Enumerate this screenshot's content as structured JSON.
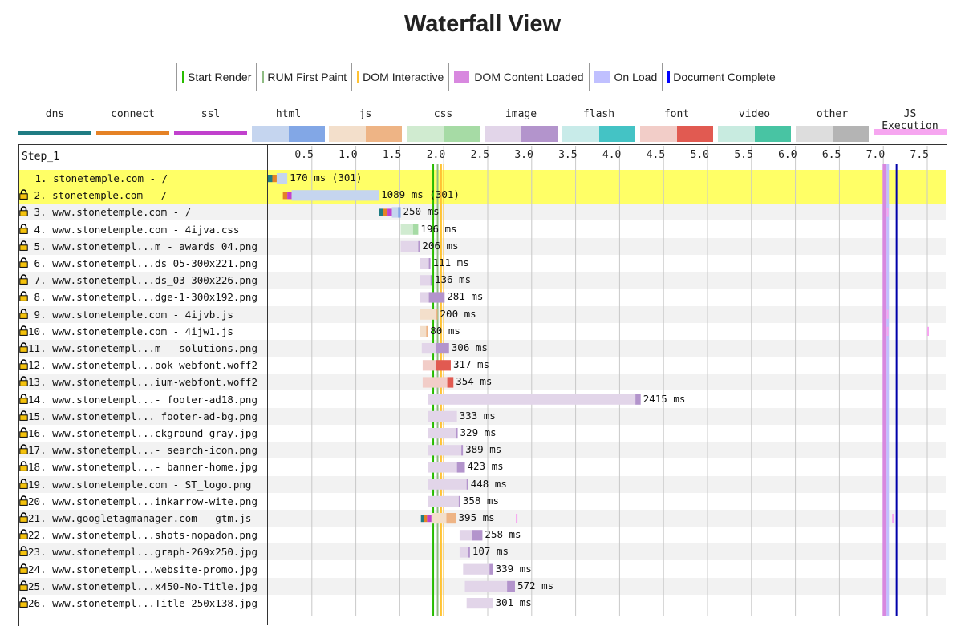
{
  "title": "Waterfall View",
  "legend": [
    {
      "label": "Start Render",
      "color": "#28BC00",
      "kind": "line"
    },
    {
      "label": "RUM First Paint",
      "color": "#8FBC83",
      "kind": "line"
    },
    {
      "label": "DOM Interactive",
      "color": "#FFC233",
      "kind": "line"
    },
    {
      "label": "DOM Content Loaded",
      "color": "#D888DF",
      "kind": "box"
    },
    {
      "label": "On Load",
      "color": "#C0C0FF",
      "kind": "box"
    },
    {
      "label": "Document Complete",
      "color": "#0000FF",
      "kind": "line"
    }
  ],
  "request_types": [
    {
      "label": "dns",
      "light": "#1f7c83",
      "dark": "#1f7c83"
    },
    {
      "label": "connect",
      "light": "#e58226",
      "dark": "#e58226"
    },
    {
      "label": "ssl",
      "light": "#c141cd",
      "dark": "#c141cd"
    },
    {
      "label": "html",
      "light": "#c5d5ef",
      "dark": "#82a7e6"
    },
    {
      "label": "js",
      "light": "#f3dfcb",
      "dark": "#eeb485"
    },
    {
      "label": "css",
      "light": "#d0ebd0",
      "dark": "#a6dba5"
    },
    {
      "label": "image",
      "light": "#e2d5e9",
      "dark": "#b394cc"
    },
    {
      "label": "flash",
      "light": "#c8ebe9",
      "dark": "#44c3c5"
    },
    {
      "label": "font",
      "light": "#f2cdc8",
      "dark": "#e15a51"
    },
    {
      "label": "video",
      "light": "#c8ebe0",
      "dark": "#48c4a3"
    },
    {
      "label": "other",
      "light": "#dddddd",
      "dark": "#b4b4b4"
    },
    {
      "label": "JS Execution",
      "light": "#f6a6f0",
      "dark": "#f6a6f0"
    }
  ],
  "chart_data": {
    "type": "waterfall",
    "step_label": "Step_1",
    "x_unit": "seconds",
    "xlim": [
      0,
      7.75
    ],
    "ticks": [
      "0.5",
      "1.0",
      "1.5",
      "2.0",
      "2.5",
      "3.0",
      "3.5",
      "4.0",
      "4.5",
      "5.0",
      "5.5",
      "6.0",
      "6.5",
      "7.0",
      "7.5"
    ],
    "markers": {
      "start_render": 1.88,
      "rum_first_paint": 1.93,
      "dom_interactive": 1.97,
      "dom_content_loaded": [
        7.01,
        7.05
      ],
      "on_load": [
        7.01,
        7.02
      ],
      "document_complete": 7.15
    },
    "requests": [
      {
        "label": "1. stonetemple.com - /",
        "secure": false,
        "highlight": true,
        "type": "html",
        "start": 0.0,
        "dns": 0.05,
        "connect": 0.05,
        "ssl": 0,
        "ttfb": 0.12,
        "download": 0.0,
        "duration": "170 ms (301)"
      },
      {
        "label": "2. stonetemple.com - /",
        "secure": true,
        "highlight": true,
        "type": "html",
        "start": 0.17,
        "dns": 0.0,
        "connect": 0.05,
        "ssl": 0.05,
        "ttfb": 0.99,
        "download": 0.0,
        "duration": "1089 ms (301)"
      },
      {
        "label": "3. www.stonetemple.com - /",
        "secure": true,
        "highlight": false,
        "type": "html",
        "start": 1.26,
        "dns": 0.05,
        "connect": 0.05,
        "ssl": 0.05,
        "ttfb": 0.07,
        "download": 0.03,
        "duration": "250 ms"
      },
      {
        "label": "4. www.stonetemple.com - 4ijva.css",
        "secure": true,
        "highlight": false,
        "type": "css",
        "start": 1.51,
        "dns": 0,
        "connect": 0,
        "ssl": 0,
        "ttfb": 0.14,
        "download": 0.06,
        "duration": "196 ms"
      },
      {
        "label": "5. www.stonetempl...m - awards_04.png",
        "secure": true,
        "highlight": false,
        "type": "image",
        "start": 1.51,
        "dns": 0,
        "connect": 0,
        "ssl": 0,
        "ttfb": 0.2,
        "download": 0.01,
        "duration": "206 ms"
      },
      {
        "label": "6. www.stonetempl...ds_05-300x221.png",
        "secure": true,
        "highlight": false,
        "type": "image",
        "start": 1.73,
        "dns": 0,
        "connect": 0,
        "ssl": 0,
        "ttfb": 0.1,
        "download": 0.01,
        "duration": "111 ms"
      },
      {
        "label": "7. www.stonetempl...ds_03-300x226.png",
        "secure": true,
        "highlight": false,
        "type": "image",
        "start": 1.73,
        "dns": 0,
        "connect": 0,
        "ssl": 0,
        "ttfb": 0.12,
        "download": 0.02,
        "duration": "136 ms"
      },
      {
        "label": "8. www.stonetempl...dge-1-300x192.png",
        "secure": true,
        "highlight": false,
        "type": "image",
        "start": 1.73,
        "dns": 0,
        "connect": 0,
        "ssl": 0,
        "ttfb": 0.1,
        "download": 0.18,
        "duration": "281 ms"
      },
      {
        "label": "9. www.stonetemple.com - 4ijvb.js",
        "secure": true,
        "highlight": false,
        "type": "js",
        "start": 1.73,
        "dns": 0,
        "connect": 0,
        "ssl": 0,
        "ttfb": 0.18,
        "download": 0.02,
        "duration": "200 ms"
      },
      {
        "label": "10. www.stonetemple.com - 4ijw1.js",
        "secure": true,
        "highlight": false,
        "type": "js",
        "start": 1.73,
        "dns": 0,
        "connect": 0,
        "ssl": 0,
        "ttfb": 0.07,
        "download": 0.01,
        "duration": "80 ms"
      },
      {
        "label": "11. www.stonetempl...m - solutions.png",
        "secure": true,
        "highlight": false,
        "type": "image",
        "start": 1.75,
        "dns": 0,
        "connect": 0,
        "ssl": 0,
        "ttfb": 0.16,
        "download": 0.15,
        "duration": "306 ms"
      },
      {
        "label": "12. www.stonetempl...ook-webfont.woff2",
        "secure": true,
        "highlight": false,
        "type": "font",
        "start": 1.76,
        "dns": 0,
        "connect": 0,
        "ssl": 0,
        "ttfb": 0.15,
        "download": 0.17,
        "duration": "317 ms"
      },
      {
        "label": "13. www.stonetempl...ium-webfont.woff2",
        "secure": true,
        "highlight": false,
        "type": "font",
        "start": 1.76,
        "dns": 0,
        "connect": 0,
        "ssl": 0,
        "ttfb": 0.28,
        "download": 0.07,
        "duration": "354 ms"
      },
      {
        "label": "14. www.stonetempl...- footer-ad18.png",
        "secure": true,
        "highlight": false,
        "type": "image",
        "start": 1.82,
        "dns": 0,
        "connect": 0,
        "ssl": 0,
        "ttfb": 2.36,
        "download": 0.06,
        "duration": "2415 ms"
      },
      {
        "label": "15. www.stonetempl... footer-ad-bg.png",
        "secure": true,
        "highlight": false,
        "type": "image",
        "start": 1.82,
        "dns": 0,
        "connect": 0,
        "ssl": 0,
        "ttfb": 0.33,
        "download": 0.0,
        "duration": "333 ms"
      },
      {
        "label": "16. www.stonetempl...ckground-gray.jpg",
        "secure": true,
        "highlight": false,
        "type": "image",
        "start": 1.82,
        "dns": 0,
        "connect": 0,
        "ssl": 0,
        "ttfb": 0.32,
        "download": 0.01,
        "duration": "329 ms"
      },
      {
        "label": "17. www.stonetempl...- search-icon.png",
        "secure": true,
        "highlight": false,
        "type": "image",
        "start": 1.82,
        "dns": 0,
        "connect": 0,
        "ssl": 0,
        "ttfb": 0.38,
        "download": 0.01,
        "duration": "389 ms"
      },
      {
        "label": "18. www.stonetempl...- banner-home.jpg",
        "secure": true,
        "highlight": false,
        "type": "image",
        "start": 1.82,
        "dns": 0,
        "connect": 0,
        "ssl": 0,
        "ttfb": 0.33,
        "download": 0.09,
        "duration": "423 ms"
      },
      {
        "label": "19. www.stonetemple.com - ST_logo.png",
        "secure": true,
        "highlight": false,
        "type": "image",
        "start": 1.82,
        "dns": 0,
        "connect": 0,
        "ssl": 0,
        "ttfb": 0.44,
        "download": 0.01,
        "duration": "448 ms"
      },
      {
        "label": "20. www.stonetempl...inkarrow-wite.png",
        "secure": true,
        "highlight": false,
        "type": "image",
        "start": 1.82,
        "dns": 0,
        "connect": 0,
        "ssl": 0,
        "ttfb": 0.35,
        "download": 0.01,
        "duration": "358 ms"
      },
      {
        "label": "21. www.googletagmanager.com - gtm.js",
        "secure": true,
        "highlight": false,
        "type": "js",
        "start": 1.74,
        "dns": 0.03,
        "connect": 0.04,
        "ssl": 0.05,
        "ttfb": 0.17,
        "download": 0.11,
        "duration": "395 ms"
      },
      {
        "label": "22. www.stonetempl...shots-nopadon.png",
        "secure": true,
        "highlight": false,
        "type": "image",
        "start": 2.18,
        "dns": 0,
        "connect": 0,
        "ssl": 0,
        "ttfb": 0.14,
        "download": 0.12,
        "duration": "258 ms"
      },
      {
        "label": "23. www.stonetempl...graph-269x250.jpg",
        "secure": true,
        "highlight": false,
        "type": "image",
        "start": 2.18,
        "dns": 0,
        "connect": 0,
        "ssl": 0,
        "ttfb": 0.1,
        "download": 0.01,
        "duration": "107 ms"
      },
      {
        "label": "24. www.stonetempl...website-promo.jpg",
        "secure": true,
        "highlight": false,
        "type": "image",
        "start": 2.22,
        "dns": 0,
        "connect": 0,
        "ssl": 0,
        "ttfb": 0.3,
        "download": 0.04,
        "duration": "339 ms"
      },
      {
        "label": "25. www.stonetempl...x450-No-Title.jpg",
        "secure": true,
        "highlight": false,
        "type": "image",
        "start": 2.24,
        "dns": 0,
        "connect": 0,
        "ssl": 0,
        "ttfb": 0.48,
        "download": 0.09,
        "duration": "572 ms"
      },
      {
        "label": "26. www.stonetempl...Title-250x138.jpg",
        "secure": true,
        "highlight": false,
        "type": "image",
        "start": 2.26,
        "dns": 0,
        "connect": 0,
        "ssl": 0,
        "ttfb": 0.3,
        "download": 0.0,
        "duration": "301 ms"
      }
    ]
  }
}
